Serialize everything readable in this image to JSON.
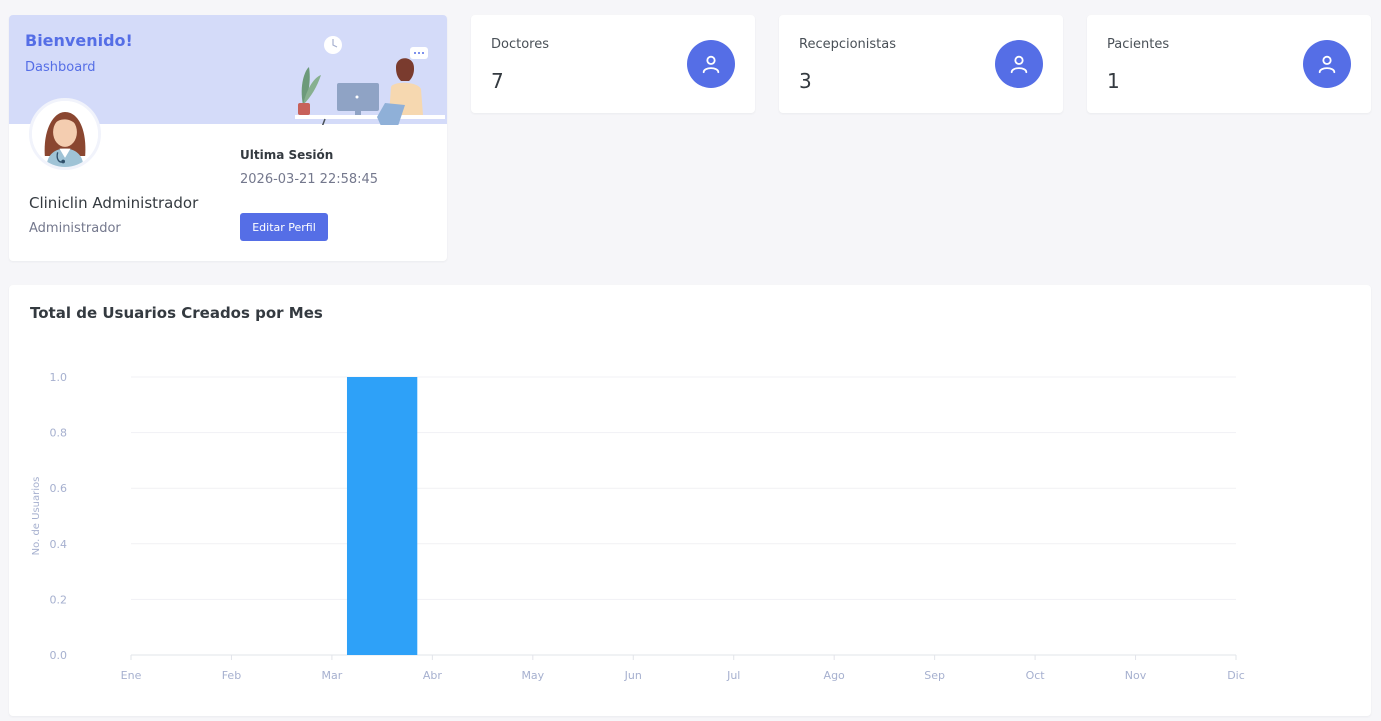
{
  "profile": {
    "welcome": "Bienvenido!",
    "breadcrumb": "Dashboard",
    "name": "Cliniclin Administrador",
    "role": "Administrador",
    "last_session_label": "Ultima Sesión",
    "last_session_value": "2026-03-21 22:58:45",
    "edit_button": "Editar Perfil"
  },
  "stats": [
    {
      "label": "Doctores",
      "value": "7",
      "icon": "user-icon"
    },
    {
      "label": "Recepcionistas",
      "value": "3",
      "icon": "user-icon"
    },
    {
      "label": "Pacientes",
      "value": "1",
      "icon": "user-icon"
    }
  ],
  "colors": {
    "accent": "#556ee6",
    "banner": "#d4dbf9",
    "bar": "#2ea1f8"
  },
  "chart_data": {
    "type": "bar",
    "title": "Total de Usuarios Creados por Mes",
    "xlabel": "",
    "ylabel": "No. de Usuarios",
    "categories": [
      "Ene",
      "Feb",
      "Mar",
      "Abr",
      "May",
      "Jun",
      "Jul",
      "Ago",
      "Sep",
      "Oct",
      "Nov",
      "Dic"
    ],
    "values": [
      0,
      0,
      1,
      0,
      0,
      0,
      0,
      0,
      0,
      0,
      0,
      0
    ],
    "ylim": [
      0,
      1
    ],
    "yticks": [
      "0.0",
      "0.2",
      "0.4",
      "0.6",
      "0.8",
      "1.0"
    ],
    "grid": true,
    "legend": "none"
  }
}
